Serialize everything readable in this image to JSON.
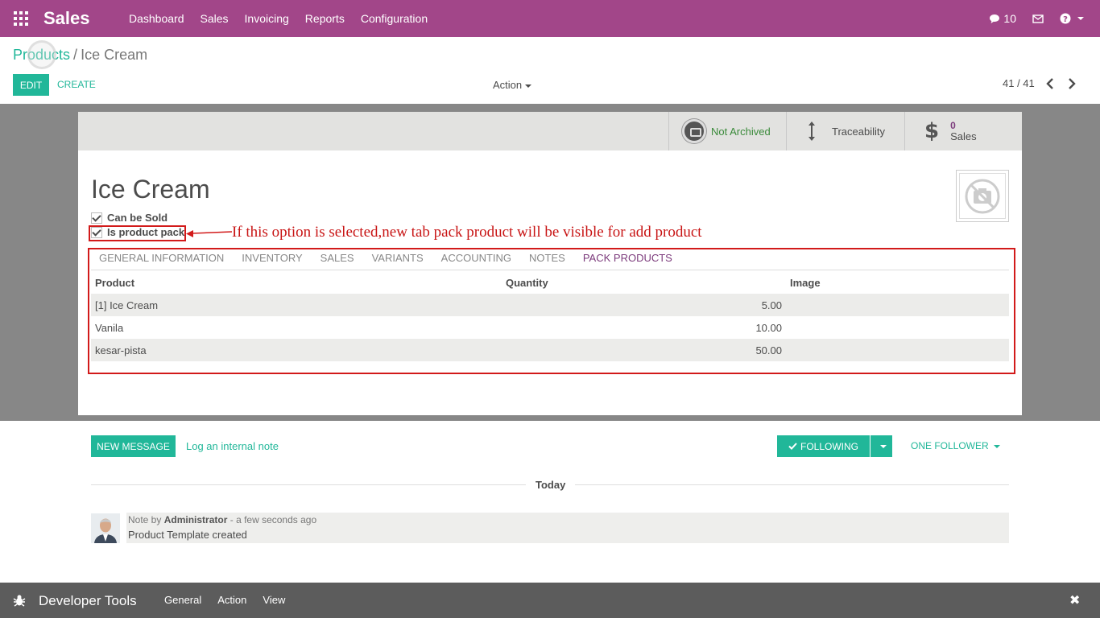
{
  "nav": {
    "brand": "Sales",
    "menu": [
      "Dashboard",
      "Sales",
      "Invoicing",
      "Reports",
      "Configuration"
    ],
    "messages_count": "10"
  },
  "breadcrumb": {
    "parent": "Products",
    "separator": "/",
    "current": "Ice Cream"
  },
  "control": {
    "edit_label": "EDIT",
    "create_label": "CREATE",
    "action_label": "Action",
    "pager": "41 / 41"
  },
  "stat_buttons": {
    "archived": "Not Archived",
    "traceability": "Traceability",
    "sales_count": "0",
    "sales_label": "Sales"
  },
  "product": {
    "name": "Ice Cream",
    "can_be_sold_label": "Can be Sold",
    "is_pack_label": "Is product pack"
  },
  "annotation": "If this option is selected,new tab pack product will be visible for add product",
  "tabs": [
    "GENERAL INFORMATION",
    "INVENTORY",
    "SALES",
    "VARIANTS",
    "ACCOUNTING",
    "NOTES",
    "PACK PRODUCTS"
  ],
  "pack_table": {
    "columns": [
      "Product",
      "Quantity",
      "Image"
    ],
    "rows": [
      {
        "product": "[1] Ice Cream",
        "quantity": "5.00"
      },
      {
        "product": "Vanila",
        "quantity": "10.00"
      },
      {
        "product": "kesar-pista",
        "quantity": "50.00"
      }
    ]
  },
  "chatter": {
    "new_message": "NEW MESSAGE",
    "log_note": "Log an internal note",
    "following": "FOLLOWING",
    "followers": "ONE FOLLOWER",
    "today": "Today",
    "message": {
      "prefix": "Note by",
      "author": "Administrator",
      "time": "- a few seconds ago",
      "text": "Product Template created"
    }
  },
  "devtools": {
    "title": "Developer Tools",
    "menu": [
      "General",
      "Action",
      "View"
    ]
  },
  "colors": {
    "navbar": "#a24689",
    "accent": "#21b799",
    "annotation": "#d21a1a",
    "active_tab": "#7c3b7c"
  }
}
